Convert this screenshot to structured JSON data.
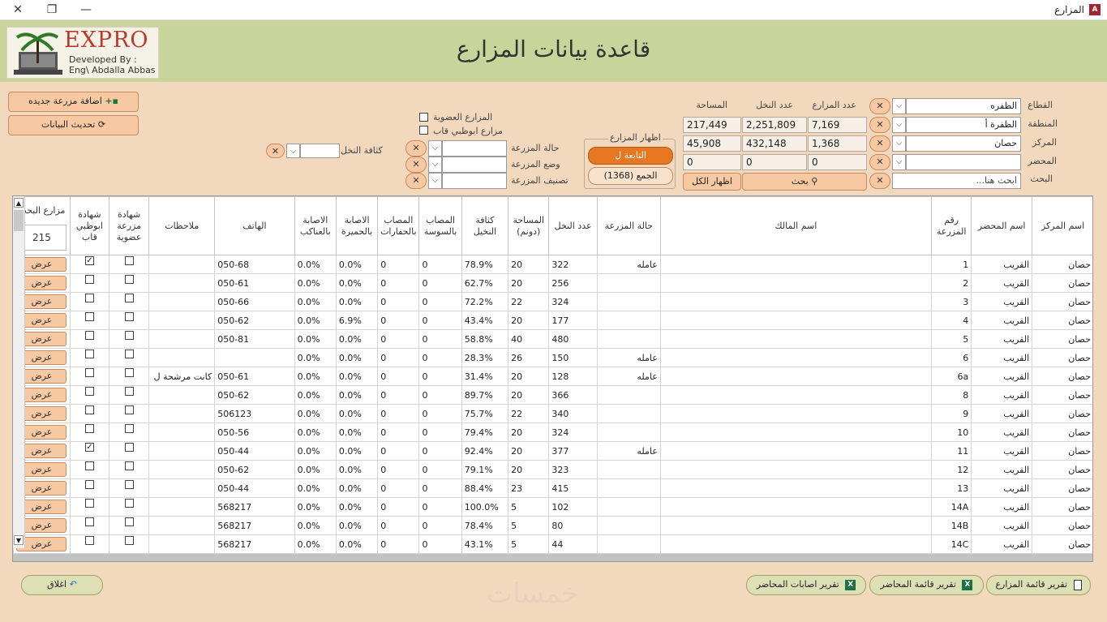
{
  "window": {
    "title": "المزارع",
    "app_icon": "A",
    "minimize": "—",
    "restore": "❐",
    "close": "✕"
  },
  "header": {
    "title": "قاعدة بيانات المزارع",
    "logo": {
      "brand": "EXPRO",
      "dev1": "Developed By :",
      "dev2": "Eng\\ Abdalla Abbas"
    }
  },
  "actions": {
    "add": "اضافة مزرعة جديده",
    "refresh": "تحديث البيانات"
  },
  "filters": {
    "sector": {
      "label": "القطاع",
      "value": "الظفره"
    },
    "region": {
      "label": "المنطقة",
      "value": "الظفرة أ"
    },
    "center": {
      "label": "المركز",
      "value": "حصان"
    },
    "mahdar": {
      "label": "المحضر",
      "value": ""
    },
    "search": {
      "label": "البحث",
      "placeholder": "ابحث هنا..."
    },
    "farm_state": {
      "label": "حالة المزرعة"
    },
    "farm_position": {
      "label": "وضع المزرعة"
    },
    "farm_class": {
      "label": "تصنيف المزرعة"
    },
    "palm_density": {
      "label": "كثافة النخل"
    },
    "organic": {
      "label": "المزارع العضوية"
    },
    "abudhabi": {
      "label": "مزارع ابوظبي قاب"
    }
  },
  "stats": {
    "headers": {
      "farms": "عدد المزارع",
      "palms": "عدد النخل",
      "area": "المساحة"
    },
    "rows": [
      [
        "7,169",
        "2,251,809",
        "217,449"
      ],
      [
        "1,368",
        "432,148",
        "45,908"
      ],
      [
        "0",
        "0",
        "0"
      ]
    ]
  },
  "show_farms": {
    "label": "اظهار المزارع",
    "tab_active": "التابعة ل",
    "tab_all": "الجمع (1368)"
  },
  "search_btn": "بحث",
  "show_all_btn": "اظهار الكل",
  "grid": {
    "headers": {
      "center": "اسم المركز",
      "mahdar": "اسم المحضر",
      "farm_no": "رقم المزرعة",
      "owner": "اسم المالك",
      "state": "حالة المزرعة",
      "palms": "عدد النخل",
      "area": "المساحة (دونم)",
      "density": "كثافة النخيل",
      "sosa": "المصاب بالسوسة",
      "hafar": "المصاب بالحفارات",
      "humaira": "الاصابة بالحميرة",
      "anakib": "الاصابة بالعناكب",
      "phone": "الهاتف",
      "notes": "ملاحظات",
      "organic": "شهادة مزرعة عضوية",
      "abudhabi": "شهادة ابوظبي قاب",
      "search_farms": "مزارع البحث"
    },
    "search_count": "215",
    "view_label": "عرض",
    "rows": [
      {
        "center": "حصان",
        "mahdar": "القريب",
        "farm_no": "1",
        "owner": "",
        "state": "عامله",
        "palms": "322",
        "area": "20",
        "density": "78.9%",
        "sosa": "0",
        "hafar": "0",
        "humaira": "0.0%",
        "anakib": "0.0%",
        "phone": "050-68",
        "notes": "",
        "organic": false,
        "abudhabi": true
      },
      {
        "center": "حصان",
        "mahdar": "القريب",
        "farm_no": "2",
        "owner": "",
        "state": "",
        "palms": "256",
        "area": "20",
        "density": "62.7%",
        "sosa": "0",
        "hafar": "0",
        "humaira": "0.0%",
        "anakib": "0.0%",
        "phone": "050-61",
        "notes": "",
        "organic": false,
        "abudhabi": false
      },
      {
        "center": "حصان",
        "mahdar": "القريب",
        "farm_no": "3",
        "owner": "",
        "state": "",
        "palms": "324",
        "area": "22",
        "density": "72.2%",
        "sosa": "0",
        "hafar": "0",
        "humaira": "0.0%",
        "anakib": "0.0%",
        "phone": "050-66",
        "notes": "",
        "organic": false,
        "abudhabi": false
      },
      {
        "center": "حصان",
        "mahdar": "القريب",
        "farm_no": "4",
        "owner": "",
        "state": "",
        "palms": "177",
        "area": "20",
        "density": "43.4%",
        "sosa": "0",
        "hafar": "0",
        "humaira": "6.9%",
        "anakib": "0.0%",
        "phone": "050-62",
        "notes": "",
        "organic": false,
        "abudhabi": false
      },
      {
        "center": "حصان",
        "mahdar": "القريب",
        "farm_no": "5",
        "owner": "",
        "state": "",
        "palms": "480",
        "area": "40",
        "density": "58.8%",
        "sosa": "0",
        "hafar": "0",
        "humaira": "0.0%",
        "anakib": "0.0%",
        "phone": "050-81",
        "notes": "",
        "organic": false,
        "abudhabi": false
      },
      {
        "center": "حصان",
        "mahdar": "القريب",
        "farm_no": "6",
        "owner": "",
        "state": "عامله",
        "palms": "150",
        "area": "26",
        "density": "28.3%",
        "sosa": "0",
        "hafar": "0",
        "humaira": "0.0%",
        "anakib": "0.0%",
        "phone": "",
        "notes": "",
        "organic": false,
        "abudhabi": false
      },
      {
        "center": "حصان",
        "mahdar": "القريب",
        "farm_no": "6a",
        "owner": "",
        "state": "عامله",
        "palms": "128",
        "area": "20",
        "density": "31.4%",
        "sosa": "0",
        "hafar": "0",
        "humaira": "0.0%",
        "anakib": "0.0%",
        "phone": "050-61",
        "notes": "كانت مرشحة ل",
        "organic": false,
        "abudhabi": false
      },
      {
        "center": "حصان",
        "mahdar": "القريب",
        "farm_no": "8",
        "owner": "",
        "state": "",
        "palms": "366",
        "area": "20",
        "density": "89.7%",
        "sosa": "0",
        "hafar": "0",
        "humaira": "0.0%",
        "anakib": "0.0%",
        "phone": "050-62",
        "notes": "",
        "organic": false,
        "abudhabi": false
      },
      {
        "center": "حصان",
        "mahdar": "القريب",
        "farm_no": "9",
        "owner": "",
        "state": "",
        "palms": "340",
        "area": "22",
        "density": "75.7%",
        "sosa": "0",
        "hafar": "0",
        "humaira": "0.0%",
        "anakib": "0.0%",
        "phone": "506123",
        "notes": "",
        "organic": false,
        "abudhabi": false
      },
      {
        "center": "حصان",
        "mahdar": "القريب",
        "farm_no": "10",
        "owner": "",
        "state": "",
        "palms": "324",
        "area": "20",
        "density": "79.4%",
        "sosa": "0",
        "hafar": "0",
        "humaira": "0.0%",
        "anakib": "0.0%",
        "phone": "050-56",
        "notes": "",
        "organic": false,
        "abudhabi": false
      },
      {
        "center": "حصان",
        "mahdar": "القريب",
        "farm_no": "11",
        "owner": "",
        "state": "عامله",
        "palms": "377",
        "area": "20",
        "density": "92.4%",
        "sosa": "0",
        "hafar": "0",
        "humaira": "0.0%",
        "anakib": "0.0%",
        "phone": "050-44",
        "notes": "",
        "organic": false,
        "abudhabi": true
      },
      {
        "center": "حصان",
        "mahdar": "القريب",
        "farm_no": "12",
        "owner": "",
        "state": "",
        "palms": "323",
        "area": "20",
        "density": "79.1%",
        "sosa": "0",
        "hafar": "0",
        "humaira": "0.0%",
        "anakib": "0.0%",
        "phone": "050-62",
        "notes": "",
        "organic": false,
        "abudhabi": false
      },
      {
        "center": "حصان",
        "mahdar": "القريب",
        "farm_no": "13",
        "owner": "",
        "state": "",
        "palms": "415",
        "area": "23",
        "density": "88.4%",
        "sosa": "0",
        "hafar": "0",
        "humaira": "0.0%",
        "anakib": "0.0%",
        "phone": "050-44",
        "notes": "",
        "organic": false,
        "abudhabi": false
      },
      {
        "center": "حصان",
        "mahdar": "القريب",
        "farm_no": "14A",
        "owner": "",
        "state": "",
        "palms": "102",
        "area": "5",
        "density": "100.0%",
        "sosa": "0",
        "hafar": "0",
        "humaira": "0.0%",
        "anakib": "0.0%",
        "phone": "568217",
        "notes": "",
        "organic": false,
        "abudhabi": false
      },
      {
        "center": "حصان",
        "mahdar": "القريب",
        "farm_no": "14B",
        "owner": "",
        "state": "",
        "palms": "80",
        "area": "5",
        "density": "78.4%",
        "sosa": "0",
        "hafar": "0",
        "humaira": "0.0%",
        "anakib": "0.0%",
        "phone": "568217",
        "notes": "",
        "organic": false,
        "abudhabi": false
      },
      {
        "center": "حصان",
        "mahdar": "القريب",
        "farm_no": "14C",
        "owner": "",
        "state": "",
        "palms": "44",
        "area": "5",
        "density": "43.1%",
        "sosa": "0",
        "hafar": "0",
        "humaira": "0.0%",
        "anakib": "0.0%",
        "phone": "568217",
        "notes": "",
        "organic": false,
        "abudhabi": false
      }
    ]
  },
  "footer": {
    "close": "اغلاق",
    "report_farms": "تقرير قائمة المزارع",
    "report_mahdar": "تقرير قائمة المحاضر",
    "report_infections": "تقرير اصابات المحاضر",
    "watermark": "خمسات"
  }
}
